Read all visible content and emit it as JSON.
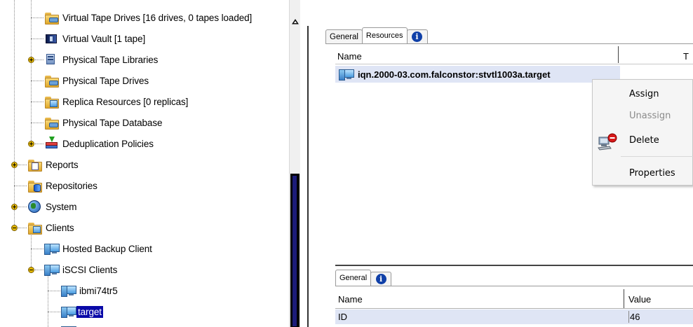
{
  "tree": {
    "items": [
      {
        "label": "Virtual Tape Drives [16 drives, 0 tapes loaded]",
        "icon": "tape-drives-folder-icon"
      },
      {
        "label": "Virtual Vault [1 tape]",
        "icon": "vault-icon"
      },
      {
        "label": "Physical Tape Libraries",
        "icon": "tape-library-icon"
      },
      {
        "label": "Physical Tape Drives",
        "icon": "tape-drives-folder-icon"
      },
      {
        "label": "Replica Resources [0 replicas]",
        "icon": "replica-folder-icon"
      },
      {
        "label": "Physical Tape Database",
        "icon": "tape-database-folder-icon"
      },
      {
        "label": "Deduplication Policies",
        "icon": "deduplication-icon"
      },
      {
        "label": "Reports",
        "icon": "reports-folder-icon"
      },
      {
        "label": "Repositories",
        "icon": "repositories-folder-icon"
      },
      {
        "label": "System",
        "icon": "globe-icon"
      },
      {
        "label": "Clients",
        "icon": "clients-folder-icon"
      },
      {
        "label": "Hosted Backup Client",
        "icon": "client-icon"
      },
      {
        "label": "iSCSI Clients",
        "icon": "client-icon"
      },
      {
        "label": "ibmi74tr5",
        "icon": "client-icon"
      },
      {
        "label": "target",
        "icon": "client-icon",
        "selected": true
      }
    ]
  },
  "resources_panel": {
    "tabs": [
      {
        "label": "General",
        "active": false
      },
      {
        "label": "Resources",
        "active": true
      },
      {
        "label": "",
        "icon": "info-icon"
      }
    ],
    "columns": [
      "Name",
      "T"
    ],
    "rows": [
      {
        "name": "iqn.2000-03.com.falconstor:stvtl1003a.target",
        "icon": "client-icon"
      }
    ]
  },
  "context_menu": {
    "items": [
      {
        "label": "Assign",
        "enabled": true
      },
      {
        "label": "Unassign",
        "enabled": false
      },
      {
        "label": "Delete",
        "enabled": true,
        "icon": "delete-client-icon"
      },
      {
        "label": "Properties",
        "enabled": true
      }
    ]
  },
  "properties_panel": {
    "tabs": [
      {
        "label": "General",
        "active": true
      },
      {
        "label": "",
        "icon": "info-icon"
      }
    ],
    "columns": [
      "Name",
      "Value"
    ],
    "rows": [
      {
        "name": "ID",
        "value": "46"
      }
    ]
  },
  "colors": {
    "selection": "#0a0aa8",
    "row_highlight": "#dfe5f5",
    "menu_background": "#f5f5f5",
    "disabled_text": "#8a8a8a",
    "info_blue": "#1040a8"
  }
}
